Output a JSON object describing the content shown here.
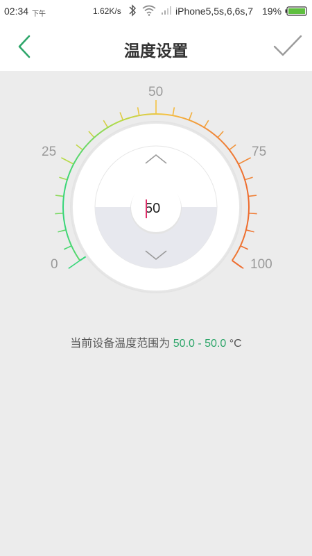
{
  "status_bar": {
    "time": "02:34",
    "ampm": "下午",
    "net_speed": "1.62K/s",
    "carrier": "iPhone5,5s,6,6s,7",
    "battery": "19%"
  },
  "header": {
    "title": "温度设置",
    "back_icon": "chevron-left-icon",
    "confirm_icon": "checkmark-icon",
    "accent_color": "#2ea66a"
  },
  "dial": {
    "min": 0,
    "max": 100,
    "value": "50",
    "tick_labels": [
      "0",
      "25",
      "50",
      "75",
      "100"
    ],
    "gradient_colors": [
      "#37d67a",
      "#b6db47",
      "#f5c242",
      "#f08a3a",
      "#ee6c2e"
    ],
    "up_icon": "chevron-up-icon",
    "down_icon": "chevron-down-icon"
  },
  "range": {
    "prefix": "当前设备温度范围为",
    "low": "50.0",
    "separator": "-",
    "high": "50.0",
    "unit": "°C"
  }
}
